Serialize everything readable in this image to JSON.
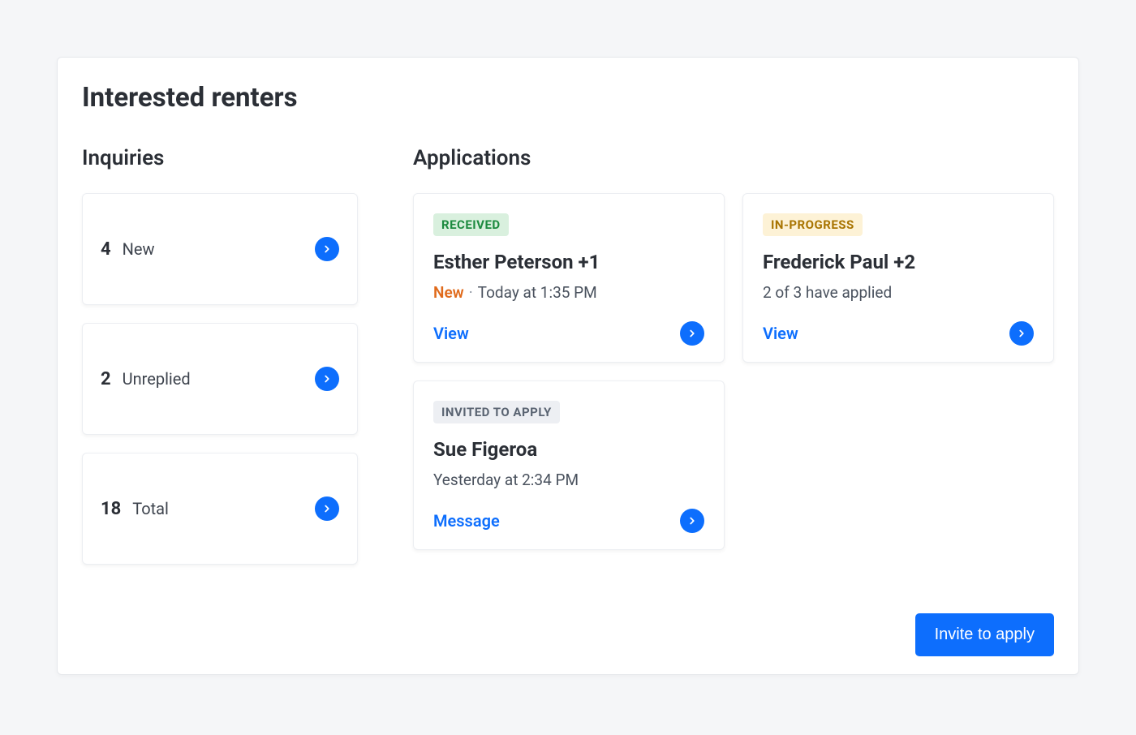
{
  "title": "Interested renters",
  "inquiries": {
    "heading": "Inquiries",
    "items": [
      {
        "count": "4",
        "label": "New"
      },
      {
        "count": "2",
        "label": "Unreplied"
      },
      {
        "count": "18",
        "label": "Total"
      }
    ]
  },
  "applications": {
    "heading": "Applications",
    "cards": [
      {
        "badge": "RECEIVED",
        "name": "Esther Peterson +1",
        "newFlag": "New",
        "dot": "·",
        "subText": "Today at 1:35 PM",
        "action": "View"
      },
      {
        "badge": "IN-PROGRESS",
        "name": "Frederick Paul +2",
        "subText": "2 of 3 have applied",
        "action": "View"
      },
      {
        "badge": "INVITED TO APPLY",
        "name": "Sue Figeroa",
        "subText": "Yesterday at 2:34 PM",
        "action": "Message"
      }
    ]
  },
  "footer": {
    "inviteButton": "Invite to apply"
  }
}
